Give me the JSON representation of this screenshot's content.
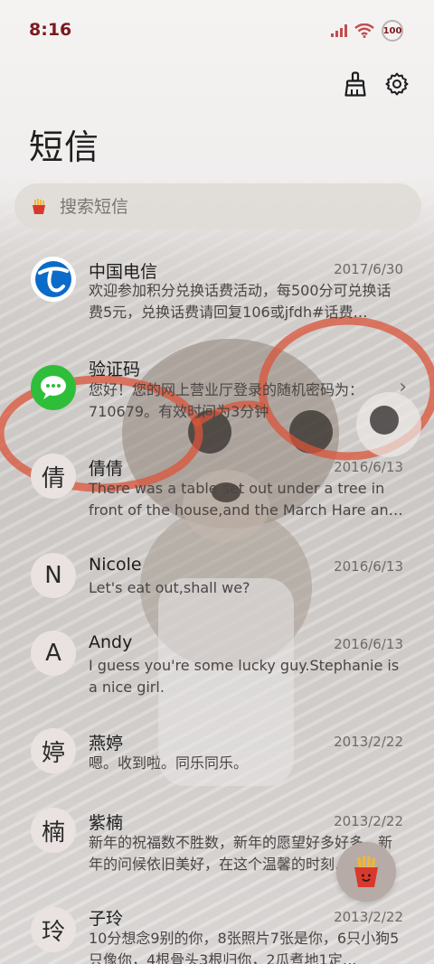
{
  "status_bar": {
    "time": "8:16",
    "battery": "100"
  },
  "header": {
    "title": "短信"
  },
  "search": {
    "placeholder": "搜索短信"
  },
  "conversations": [
    {
      "avatar": "",
      "avatar_icon": "china-telecom-logo",
      "name": "中国电信",
      "date": "2017/6/30",
      "preview": "欢迎参加积分兑换话费活动，每500分可兑换话费5元，兑换话费请回复106或jfdh#话费…"
    },
    {
      "avatar": "",
      "avatar_icon": "message-icon",
      "name": "验证码",
      "date": "",
      "preview": "您好！您的网上营业厅登录的随机密码为：710679。有效时间为3分钟"
    },
    {
      "avatar": "倩",
      "name": "倩倩",
      "date": "2016/6/13",
      "preview": "There was a table set out under a tree in front of the house,and the March Hare an…"
    },
    {
      "avatar": "N",
      "name": "Nicole",
      "date": "2016/6/13",
      "preview": "Let's eat out,shall we?"
    },
    {
      "avatar": "A",
      "name": "Andy",
      "date": "2016/6/13",
      "preview": "I guess you're some lucky guy.Stephanie is a nice girl."
    },
    {
      "avatar": "婷",
      "name": "燕婷",
      "date": "2013/2/22",
      "preview": "嗯。收到啦。同乐同乐。"
    },
    {
      "avatar": "楠",
      "name": "紫楠",
      "date": "2013/2/22",
      "preview": "新年的祝福数不胜数，新年的愿望好多好多，新年的问候依旧美好，在这个温馨的时刻…"
    },
    {
      "avatar": "玲",
      "name": "子玲",
      "date": "2013/2/22",
      "preview": "10分想念9别的你，8张照片7张是你，6只小狗5只像你，4根骨头3根归你，2瓜煮地1定…"
    }
  ],
  "colors": {
    "accent": "#7a1a1f",
    "glasses": "#d9543a",
    "fab": "#b7aba7"
  }
}
